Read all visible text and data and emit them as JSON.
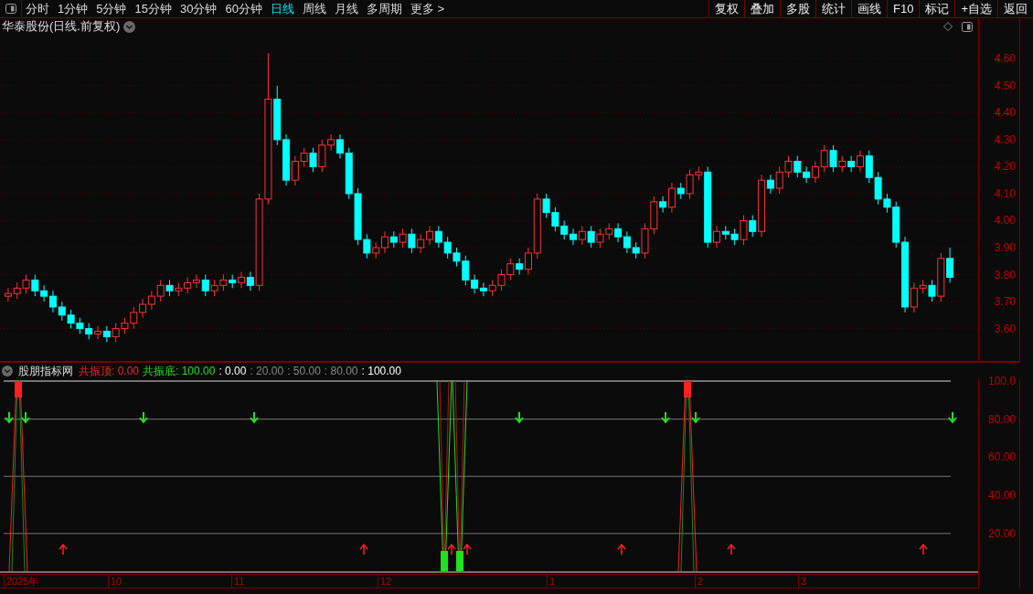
{
  "toolbar": {
    "periods": [
      {
        "label": "分时",
        "selected": false
      },
      {
        "label": "1分钟",
        "selected": false
      },
      {
        "label": "5分钟",
        "selected": false
      },
      {
        "label": "15分钟",
        "selected": false
      },
      {
        "label": "30分钟",
        "selected": false
      },
      {
        "label": "60分钟",
        "selected": false
      },
      {
        "label": "日线",
        "selected": true
      },
      {
        "label": "周线",
        "selected": false
      },
      {
        "label": "月线",
        "selected": false
      },
      {
        "label": "多周期",
        "selected": false
      },
      {
        "label": "更多 >",
        "selected": false
      }
    ],
    "buttons": [
      "复权",
      "叠加",
      "多股",
      "统计",
      "画线",
      "F10",
      "标记",
      "+自选",
      "返回"
    ]
  },
  "main_chart": {
    "title": "华泰股份(日线.前复权)",
    "chart_data": {
      "type": "candlestick",
      "ylim": [
        3.48,
        4.75
      ],
      "grid": true,
      "yticks": [
        {
          "value": 4.6,
          "label": "4.60"
        },
        {
          "value": 4.5,
          "label": "4.50"
        },
        {
          "value": 4.4,
          "label": "4.40"
        },
        {
          "value": 4.3,
          "label": "4.30"
        },
        {
          "value": 4.2,
          "label": "4.20"
        },
        {
          "value": 4.1,
          "label": "4.10"
        },
        {
          "value": 4.0,
          "label": "4.00"
        },
        {
          "value": 3.9,
          "label": "3.90"
        },
        {
          "value": 3.8,
          "label": "3.80"
        },
        {
          "value": 3.7,
          "label": "3.70"
        },
        {
          "value": 3.6,
          "label": "3.60"
        }
      ],
      "ohlc": [
        [
          3.72,
          3.75,
          3.7,
          3.73
        ],
        [
          3.73,
          3.77,
          3.71,
          3.75
        ],
        [
          3.75,
          3.8,
          3.73,
          3.78
        ],
        [
          3.78,
          3.8,
          3.72,
          3.74
        ],
        [
          3.74,
          3.76,
          3.7,
          3.72
        ],
        [
          3.72,
          3.74,
          3.66,
          3.68
        ],
        [
          3.68,
          3.7,
          3.63,
          3.65
        ],
        [
          3.65,
          3.67,
          3.6,
          3.62
        ],
        [
          3.62,
          3.64,
          3.58,
          3.6
        ],
        [
          3.6,
          3.62,
          3.56,
          3.58
        ],
        [
          3.58,
          3.61,
          3.56,
          3.59
        ],
        [
          3.59,
          3.61,
          3.55,
          3.57
        ],
        [
          3.57,
          3.62,
          3.55,
          3.6
        ],
        [
          3.6,
          3.64,
          3.58,
          3.62
        ],
        [
          3.62,
          3.68,
          3.6,
          3.66
        ],
        [
          3.66,
          3.71,
          3.64,
          3.69
        ],
        [
          3.69,
          3.74,
          3.67,
          3.72
        ],
        [
          3.72,
          3.78,
          3.7,
          3.76
        ],
        [
          3.76,
          3.78,
          3.72,
          3.74
        ],
        [
          3.74,
          3.77,
          3.72,
          3.75
        ],
        [
          3.75,
          3.79,
          3.73,
          3.77
        ],
        [
          3.77,
          3.8,
          3.75,
          3.78
        ],
        [
          3.78,
          3.8,
          3.72,
          3.74
        ],
        [
          3.74,
          3.78,
          3.72,
          3.76
        ],
        [
          3.76,
          3.8,
          3.74,
          3.78
        ],
        [
          3.78,
          3.8,
          3.75,
          3.77
        ],
        [
          3.77,
          3.81,
          3.75,
          3.79
        ],
        [
          3.79,
          3.81,
          3.74,
          3.76
        ],
        [
          3.76,
          4.1,
          3.74,
          4.08
        ],
        [
          4.08,
          4.62,
          4.06,
          4.45
        ],
        [
          4.45,
          4.5,
          4.28,
          4.3
        ],
        [
          4.3,
          4.32,
          4.13,
          4.15
        ],
        [
          4.15,
          4.24,
          4.13,
          4.22
        ],
        [
          4.22,
          4.27,
          4.2,
          4.25
        ],
        [
          4.25,
          4.27,
          4.18,
          4.2
        ],
        [
          4.2,
          4.3,
          4.18,
          4.28
        ],
        [
          4.28,
          4.32,
          4.26,
          4.3
        ],
        [
          4.3,
          4.32,
          4.23,
          4.25
        ],
        [
          4.25,
          4.27,
          4.08,
          4.1
        ],
        [
          4.1,
          4.12,
          3.91,
          3.93
        ],
        [
          3.93,
          3.95,
          3.86,
          3.88
        ],
        [
          3.88,
          3.92,
          3.86,
          3.9
        ],
        [
          3.9,
          3.96,
          3.88,
          3.94
        ],
        [
          3.94,
          3.96,
          3.9,
          3.92
        ],
        [
          3.92,
          3.97,
          3.9,
          3.95
        ],
        [
          3.95,
          3.97,
          3.88,
          3.9
        ],
        [
          3.9,
          3.95,
          3.88,
          3.93
        ],
        [
          3.93,
          3.98,
          3.91,
          3.96
        ],
        [
          3.96,
          3.98,
          3.9,
          3.92
        ],
        [
          3.92,
          3.94,
          3.86,
          3.88
        ],
        [
          3.88,
          3.9,
          3.83,
          3.85
        ],
        [
          3.85,
          3.87,
          3.76,
          3.78
        ],
        [
          3.78,
          3.8,
          3.73,
          3.75
        ],
        [
          3.75,
          3.77,
          3.72,
          3.74
        ],
        [
          3.74,
          3.78,
          3.72,
          3.76
        ],
        [
          3.76,
          3.82,
          3.74,
          3.8
        ],
        [
          3.8,
          3.86,
          3.78,
          3.84
        ],
        [
          3.84,
          3.86,
          3.8,
          3.82
        ],
        [
          3.82,
          3.9,
          3.8,
          3.88
        ],
        [
          3.88,
          4.1,
          3.86,
          4.08
        ],
        [
          4.08,
          4.1,
          4.01,
          4.03
        ],
        [
          4.03,
          4.05,
          3.96,
          3.98
        ],
        [
          3.98,
          4.0,
          3.93,
          3.95
        ],
        [
          3.95,
          3.97,
          3.91,
          3.93
        ],
        [
          3.93,
          3.98,
          3.91,
          3.96
        ],
        [
          3.96,
          3.98,
          3.9,
          3.92
        ],
        [
          3.92,
          3.97,
          3.9,
          3.95
        ],
        [
          3.95,
          3.99,
          3.93,
          3.97
        ],
        [
          3.97,
          3.99,
          3.92,
          3.94
        ],
        [
          3.94,
          3.96,
          3.88,
          3.9
        ],
        [
          3.9,
          3.92,
          3.86,
          3.88
        ],
        [
          3.88,
          3.99,
          3.86,
          3.97
        ],
        [
          3.97,
          4.09,
          3.95,
          4.07
        ],
        [
          4.07,
          4.09,
          4.03,
          4.05
        ],
        [
          4.05,
          4.14,
          4.03,
          4.12
        ],
        [
          4.12,
          4.14,
          4.08,
          4.1
        ],
        [
          4.1,
          4.19,
          4.08,
          4.17
        ],
        [
          4.17,
          4.2,
          4.15,
          4.18
        ],
        [
          4.18,
          4.2,
          3.9,
          3.92
        ],
        [
          3.92,
          3.98,
          3.9,
          3.96
        ],
        [
          3.96,
          3.98,
          3.93,
          3.95
        ],
        [
          3.95,
          3.97,
          3.91,
          3.93
        ],
        [
          3.93,
          4.02,
          3.91,
          4.0
        ],
        [
          4.0,
          4.02,
          3.94,
          3.96
        ],
        [
          3.96,
          4.17,
          3.94,
          4.15
        ],
        [
          4.15,
          4.17,
          4.1,
          4.12
        ],
        [
          4.12,
          4.2,
          4.1,
          4.18
        ],
        [
          4.18,
          4.24,
          4.16,
          4.22
        ],
        [
          4.22,
          4.24,
          4.16,
          4.18
        ],
        [
          4.18,
          4.2,
          4.14,
          4.16
        ],
        [
          4.16,
          4.22,
          4.14,
          4.2
        ],
        [
          4.2,
          4.28,
          4.18,
          4.26
        ],
        [
          4.26,
          4.28,
          4.18,
          4.2
        ],
        [
          4.2,
          4.24,
          4.18,
          4.22
        ],
        [
          4.22,
          4.24,
          4.18,
          4.2
        ],
        [
          4.2,
          4.26,
          4.18,
          4.24
        ],
        [
          4.24,
          4.26,
          4.14,
          4.16
        ],
        [
          4.16,
          4.18,
          4.06,
          4.08
        ],
        [
          4.08,
          4.1,
          4.03,
          4.05
        ],
        [
          4.05,
          4.07,
          3.9,
          3.92
        ],
        [
          3.92,
          3.94,
          3.66,
          3.68
        ],
        [
          3.68,
          3.77,
          3.66,
          3.75
        ],
        [
          3.75,
          3.78,
          3.73,
          3.76
        ],
        [
          3.76,
          3.78,
          3.7,
          3.72
        ],
        [
          3.72,
          3.88,
          3.7,
          3.86
        ],
        [
          3.86,
          3.9,
          3.77,
          3.79
        ]
      ]
    }
  },
  "indicator": {
    "name": "股朋指标网",
    "legend": [
      {
        "text": "共振顶: 0.00",
        "kind": "top"
      },
      {
        "text": "共振底: 100.00",
        "kind": "bottom"
      },
      {
        "text": ": 0.00",
        "kind": "bound"
      },
      {
        "text": ": 20.00",
        "kind": "guide"
      },
      {
        "text": ": 50.00",
        "kind": "guide"
      },
      {
        "text": ": 80.00",
        "kind": "guide"
      },
      {
        "text": ": 100.00",
        "kind": "bound"
      }
    ],
    "ticks": [
      "100.0",
      "80.00",
      "60.00",
      "40.00",
      "20.00"
    ]
  },
  "date_axis": [
    "2025年",
    "10",
    "11",
    "12",
    "1",
    "2",
    "3"
  ]
}
